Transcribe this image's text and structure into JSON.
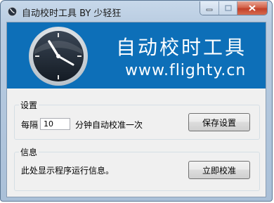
{
  "window": {
    "title": "自动校时工具 BY 少轻狂"
  },
  "banner": {
    "title": "自动校时工具",
    "url": "www.flighty.cn"
  },
  "settings": {
    "group_label": "设置",
    "interval_prefix": "每隔",
    "interval_value": "10",
    "interval_suffix": "分钟自动校准一次",
    "save_button": "保存设置"
  },
  "info": {
    "group_label": "信息",
    "message": "此处显示程序运行信息。",
    "sync_now_button": "立即校准"
  },
  "colors": {
    "banner_bg": "#0d6fb8",
    "close_button": "#c2412a"
  }
}
